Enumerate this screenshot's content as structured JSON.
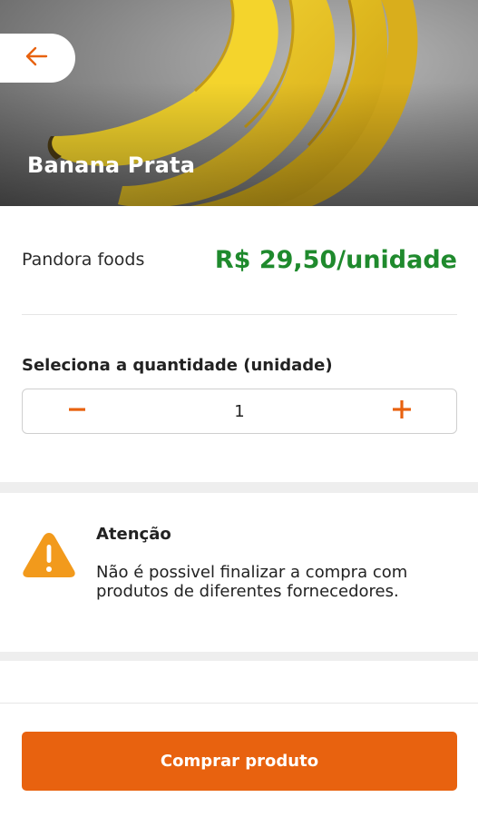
{
  "hero": {
    "title": "Banana Prata",
    "image": "banana-photo"
  },
  "icons": {
    "back": "arrow-left-icon",
    "minus": "minus-icon",
    "plus": "plus-icon",
    "warning": "warning-icon"
  },
  "supplier": {
    "name": "Pandora foods",
    "price": "R$ 29,50/unidade"
  },
  "quantity": {
    "label": "Seleciona a quantidade (unidade)",
    "value": "1"
  },
  "alert": {
    "title": "Atenção",
    "message": "Não é possivel finalizar a compra com produtos de diferentes fornecedores."
  },
  "actions": {
    "buy_label": "Comprar produto"
  },
  "colors": {
    "accent": "#e8620f",
    "price": "#1f8a2d",
    "warning": "#f29a1c"
  }
}
